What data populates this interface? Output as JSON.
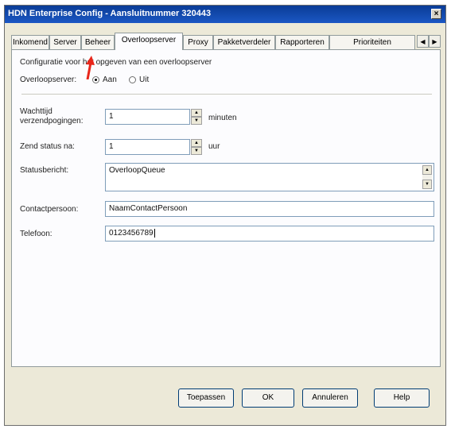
{
  "window": {
    "title": "HDN Enterprise Config - Aansluitnummer 320443",
    "close_label": "×"
  },
  "tabs": [
    {
      "label": "Inkomend"
    },
    {
      "label": "Server"
    },
    {
      "label": "Beheer"
    },
    {
      "label": "Overloopserver",
      "active": true
    },
    {
      "label": "Proxy"
    },
    {
      "label": "Pakketverdeler"
    },
    {
      "label": "Rapporteren"
    },
    {
      "label": "Prioriteiten"
    }
  ],
  "tab_scroll": {
    "left": "◀",
    "right": "▶"
  },
  "panel": {
    "description": "Configuratie voor het opgeven van een overloopserver",
    "overloopserver_label": "Overloopserver:",
    "radio_on": "Aan",
    "radio_off": "Uit",
    "selected": "Aan"
  },
  "fields": {
    "wachttijd_label_line1": "Wachttijd",
    "wachttijd_label_line2": "verzendpogingen:",
    "wachttijd_value": "1",
    "wachttijd_unit": "minuten",
    "zendstatus_label": "Zend status na:",
    "zendstatus_value": "1",
    "zendstatus_unit": "uur",
    "statusbericht_label": "Statusbericht:",
    "statusbericht_value": "OverloopQueue",
    "contactpersoon_label": "Contactpersoon:",
    "contactpersoon_value": "NaamContactPersoon",
    "telefoon_label": "Telefoon:",
    "telefoon_value": "0123456789"
  },
  "buttons": {
    "apply": "Toepassen",
    "ok": "OK",
    "cancel": "Annuleren",
    "help": "Help"
  },
  "colors": {
    "titlebar": "#0a3c96",
    "annotation_arrow": "#e8261a"
  }
}
